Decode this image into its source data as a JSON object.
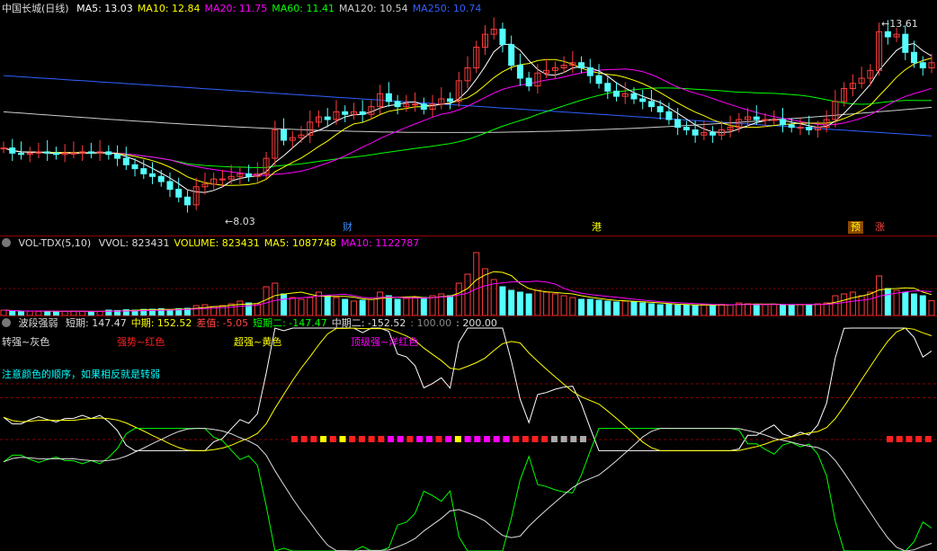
{
  "main": {
    "title": "中国长城(日线)",
    "ma": [
      {
        "label": "MA5: 13.03",
        "color": "#ffffff"
      },
      {
        "label": "MA10: 12.84",
        "color": "#ffff00"
      },
      {
        "label": "MA20: 11.75",
        "color": "#ff00ff"
      },
      {
        "label": "MA60: 11.41",
        "color": "#00ff00"
      },
      {
        "label": "MA120: 10.54",
        "color": "#cccccc"
      },
      {
        "label": "MA250: 10.74",
        "color": "#3060ff"
      }
    ],
    "high_label": "13.61",
    "low_label": "8.03",
    "markers": [
      {
        "text": "财",
        "color": "#3a8dff"
      },
      {
        "text": "港",
        "color": "#ffff00"
      },
      {
        "text": "预",
        "color": "#ffff00"
      },
      {
        "text": "涨",
        "color": "#ff4444"
      }
    ]
  },
  "volume": {
    "title": "VOL-TDX(5,10)",
    "labels": [
      {
        "text": "VVOL: 823431",
        "color": "#dddddd"
      },
      {
        "text": "VOLUME: 823431",
        "color": "#ffff00"
      },
      {
        "text": "MA5: 1087748",
        "color": "#ffff00"
      },
      {
        "text": "MA10: 1122787",
        "color": "#ff00ff"
      }
    ]
  },
  "indicator": {
    "title": "波段强弱",
    "labels": [
      {
        "text": "短期: 147.47",
        "color": "#dddddd"
      },
      {
        "text": "中期: 152.52",
        "color": "#ffff00"
      },
      {
        "text": "差值: -5.05",
        "color": "#ff4444"
      },
      {
        "text": "短期二: -147.47",
        "color": "#00ff00"
      },
      {
        "text": "中期二: -152.52",
        "color": "#dddddd"
      },
      {
        "text": ": 100.00",
        "color": "#888888"
      },
      {
        "text": ": 200.00",
        "color": "#dddddd"
      }
    ],
    "legend": [
      {
        "text": "转强~灰色",
        "color": "#dddddd"
      },
      {
        "text": "强势~红色",
        "color": "#ff2020"
      },
      {
        "text": "超强~黄色",
        "color": "#ffff00"
      },
      {
        "text": "顶级强~洋红色",
        "color": "#ff00ff"
      }
    ],
    "note": "注意颜色的顺序，如果相反就是转弱",
    "note_color": "#00ffff"
  },
  "chart_data": [
    {
      "type": "candlestick",
      "title": "中国长城(日线)",
      "series_names": [
        "MA5",
        "MA10",
        "MA20",
        "MA60",
        "MA120",
        "MA250"
      ],
      "close": [
        10.5,
        10.3,
        10.25,
        10.3,
        10.35,
        10.3,
        10.25,
        10.3,
        10.3,
        10.35,
        10.3,
        10.35,
        10.25,
        10.1,
        9.85,
        9.7,
        9.5,
        9.4,
        9.2,
        8.9,
        8.6,
        8.3,
        9.0,
        9.1,
        9.3,
        9.3,
        9.4,
        9.5,
        9.4,
        9.5,
        10.1,
        11.2,
        10.8,
        10.9,
        11.0,
        11.5,
        11.7,
        11.6,
        11.9,
        11.8,
        11.9,
        11.8,
        12.1,
        12.6,
        12.3,
        12.1,
        12.2,
        12.2,
        12.0,
        12.2,
        12.4,
        12.3,
        13.1,
        13.6,
        14.4,
        14.9,
        15.1,
        14.5,
        13.7,
        13.2,
        12.9,
        13.4,
        13.5,
        13.6,
        13.7,
        13.8,
        13.6,
        13.3,
        13.0,
        12.7,
        12.5,
        12.6,
        12.4,
        12.3,
        12.1,
        11.9,
        11.6,
        11.3,
        11.2,
        11.0,
        11.1,
        11.0,
        11.2,
        11.3,
        11.6,
        11.7,
        11.6,
        11.6,
        11.6,
        11.4,
        11.3,
        11.3,
        11.2,
        11.3,
        11.6,
        12.3,
        12.8,
        13.0,
        13.2,
        13.5,
        15.0,
        14.8,
        14.9,
        14.2,
        13.8,
        13.6,
        13.8
      ],
      "low": 8.03,
      "high": 13.61
    },
    {
      "type": "bar",
      "title": "VOL-TDX(5,10)",
      "values": [
        300000,
        250000,
        220000,
        240000,
        230000,
        250000,
        220000,
        230000,
        240000,
        230000,
        220000,
        230000,
        300000,
        280000,
        320000,
        300000,
        340000,
        350000,
        380000,
        300000,
        380000,
        400000,
        550000,
        600000,
        500000,
        550000,
        650000,
        800000,
        700000,
        650000,
        1600000,
        1800000,
        1200000,
        1000000,
        900000,
        1000000,
        1300000,
        1100000,
        1000000,
        900000,
        800000,
        850000,
        900000,
        1300000,
        1100000,
        900000,
        950000,
        1000000,
        1000000,
        1100000,
        1200000,
        1100000,
        1800000,
        2300000,
        3500000,
        2600000,
        2000000,
        1600000,
        1400000,
        1300000,
        1200000,
        1400000,
        1300000,
        1200000,
        1100000,
        1000000,
        900000,
        900000,
        850000,
        800000,
        750000,
        800000,
        750000,
        700000,
        650000,
        600000,
        620000,
        580000,
        600000,
        550000,
        600000,
        560000,
        620000,
        600000,
        700000,
        650000,
        600000,
        600000,
        620000,
        580000,
        600000,
        620000,
        600000,
        650000,
        700000,
        1100000,
        1200000,
        1300000,
        1100000,
        1300000,
        2200000,
        1500000,
        1400000,
        1300000,
        1200000,
        1100000,
        823431
      ],
      "series": [
        {
          "name": "MA5",
          "value": 1087748
        },
        {
          "name": "MA10",
          "value": 1122787
        }
      ]
    },
    {
      "type": "line",
      "title": "波段强弱",
      "ylim": [
        -200,
        200
      ],
      "series": [
        {
          "name": "短期",
          "last": 147.47
        },
        {
          "name": "中期",
          "last": 152.52
        },
        {
          "name": "差值",
          "last": -5.05
        },
        {
          "name": "短期二",
          "last": -147.47
        },
        {
          "name": "中期二",
          "last": -152.52
        }
      ],
      "reference_lines": [
        100,
        200
      ]
    }
  ]
}
